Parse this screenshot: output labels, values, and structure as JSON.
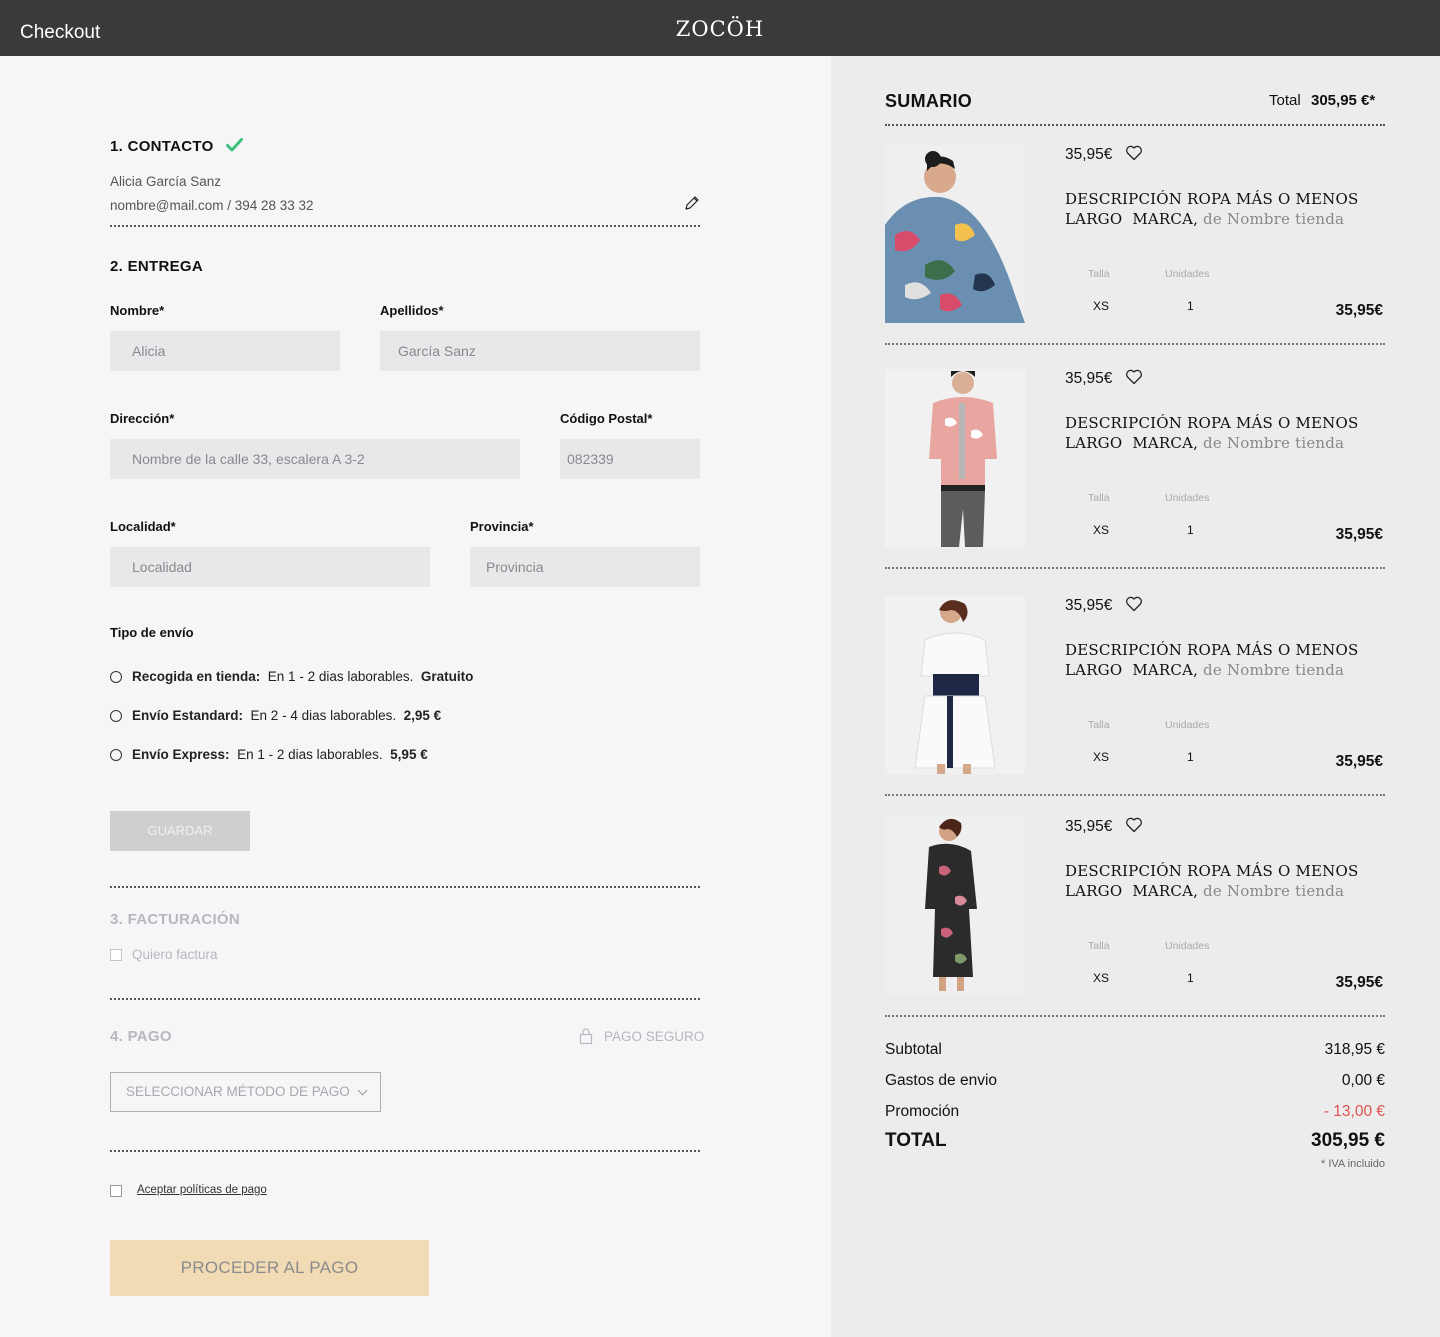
{
  "header": {
    "title": "Checkout",
    "logo": "ZOCÖH"
  },
  "contact": {
    "title": "1. CONTACTO",
    "name": "Alicia García Sanz",
    "details": "nombre@mail.com / 394 28 33 32"
  },
  "delivery": {
    "title": "2. ENTREGA",
    "fields": {
      "nombre": {
        "label": "Nombre*",
        "value": "Alicia"
      },
      "apellidos": {
        "label": "Apellidos*",
        "value": "García Sanz"
      },
      "direccion": {
        "label": "Dirección*",
        "value": "Nombre de la calle 33, escalera A 3-2"
      },
      "cp": {
        "label": "Código Postal*",
        "value": "082339"
      },
      "localidad": {
        "label": "Localidad*",
        "placeholder": "Localidad"
      },
      "provincia": {
        "label": "Provincia*",
        "placeholder": "Provincia"
      }
    },
    "shipping_label": "Tipo de envío",
    "shipping_options": [
      {
        "name": "Recogida en tienda:",
        "desc": "En 1 - 2 dias laborables.",
        "price": "Gratuito"
      },
      {
        "name": "Envío Estandard:",
        "desc": "En 2 - 4 dias laborables.",
        "price": "2,95 €"
      },
      {
        "name": "Envío Express:",
        "desc": "En 1 - 2 dias laborables.",
        "price": "5,95 €"
      }
    ],
    "save_label": "GUARDAR"
  },
  "billing": {
    "title": "3. FACTURACIÓN",
    "invoice_label": "Quiero factura"
  },
  "payment": {
    "title": "4. PAGO",
    "secure_label": "PAGO SEGURO",
    "method_placeholder": "SELECCIONAR MÉTODO DE PAGO",
    "accept_label": "Aceptar políticas de pago",
    "proceed_label": "PROCEDER AL PAGO"
  },
  "summary": {
    "title": "SUMARIO",
    "total_label": "Total",
    "total_value": "305,95 €*",
    "items": [
      {
        "price": "35,95€",
        "desc": "DESCRIPCIÓN ROPA MÁS O MENOS LARGO",
        "brand": "MARCA,",
        "store": "de Nombre tienda",
        "size_label": "Talla",
        "units_label": "Unidades",
        "size": "XS",
        "units": "1",
        "total": "35,95€"
      },
      {
        "price": "35,95€",
        "desc": "DESCRIPCIÓN ROPA MÁS O MENOS LARGO",
        "brand": "MARCA,",
        "store": "de Nombre tienda",
        "size_label": "Talla",
        "units_label": "Unidades",
        "size": "XS",
        "units": "1",
        "total": "35,95€"
      },
      {
        "price": "35,95€",
        "desc": "DESCRIPCIÓN ROPA MÁS O MENOS LARGO",
        "brand": "MARCA,",
        "store": "de Nombre tienda",
        "size_label": "Talla",
        "units_label": "Unidades",
        "size": "XS",
        "units": "1",
        "total": "35,95€"
      },
      {
        "price": "35,95€",
        "desc": "DESCRIPCIÓN ROPA MÁS O MENOS LARGO",
        "brand": "MARCA,",
        "store": "de Nombre tienda",
        "size_label": "Talla",
        "units_label": "Unidades",
        "size": "XS",
        "units": "1",
        "total": "35,95€"
      }
    ],
    "subtotal_label": "Subtotal",
    "subtotal": "318,95 €",
    "shipping_label": "Gastos de envio",
    "shipping": "0,00 €",
    "promo_label": "Promoción",
    "promo": "- 13,00 €",
    "grand_label": "TOTAL",
    "grand": "305,95 €",
    "vat_note": "* IVA incluido"
  },
  "colors": {
    "accent_check": "#3ec27f",
    "promo": "#e0534f",
    "topbar": "#3a3a3a",
    "cta": "#f1dbb5"
  }
}
